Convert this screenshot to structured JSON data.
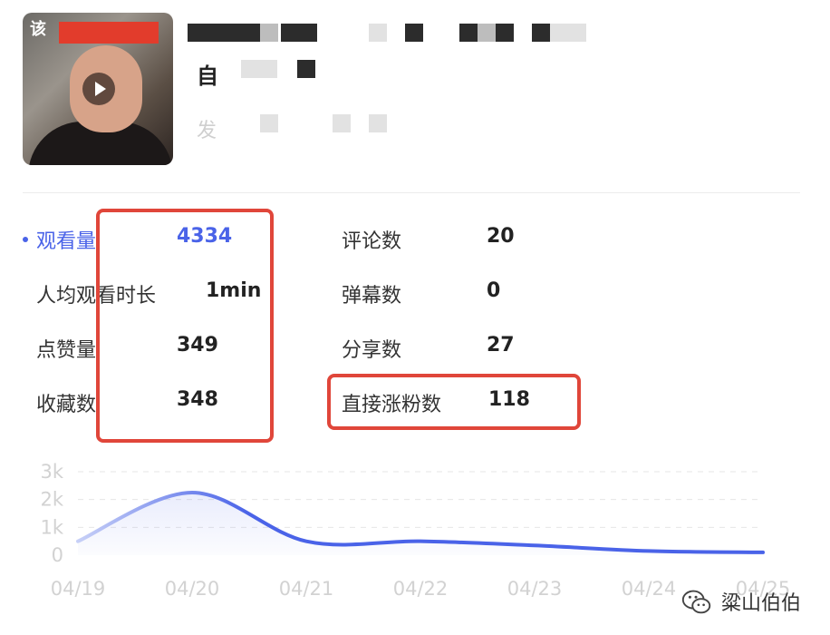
{
  "video": {
    "thumbnail_caption": "该",
    "title_line2": "自",
    "subtitle": "发"
  },
  "metrics_left": [
    {
      "label": "观看量",
      "value": "4334",
      "active": true
    },
    {
      "label": "人均观看时长",
      "value": "1min"
    },
    {
      "label": "点赞量",
      "value": "349"
    },
    {
      "label": "收藏数",
      "value": "348"
    }
  ],
  "metrics_right": [
    {
      "label": "评论数",
      "value": "20"
    },
    {
      "label": "弹幕数",
      "value": "0"
    },
    {
      "label": "分享数",
      "value": "27"
    },
    {
      "label": "直接涨粉数",
      "value": "118"
    }
  ],
  "colors": {
    "accent": "#4a63e8",
    "highlight": "#e0463a"
  },
  "chart_data": {
    "type": "area",
    "x": [
      "04/19",
      "04/20",
      "04/21",
      "04/22",
      "04/23",
      "04/24",
      "04/25"
    ],
    "y_ticks": [
      "0",
      "1k",
      "2k",
      "3k"
    ],
    "ylim": [
      0,
      3000
    ],
    "series": [
      {
        "values": [
          500,
          2250,
          500,
          500,
          350,
          150,
          100
        ]
      }
    ],
    "grid": true
  },
  "watermark": {
    "text": "粱山伯伯",
    "icon": "wechat-icon"
  }
}
